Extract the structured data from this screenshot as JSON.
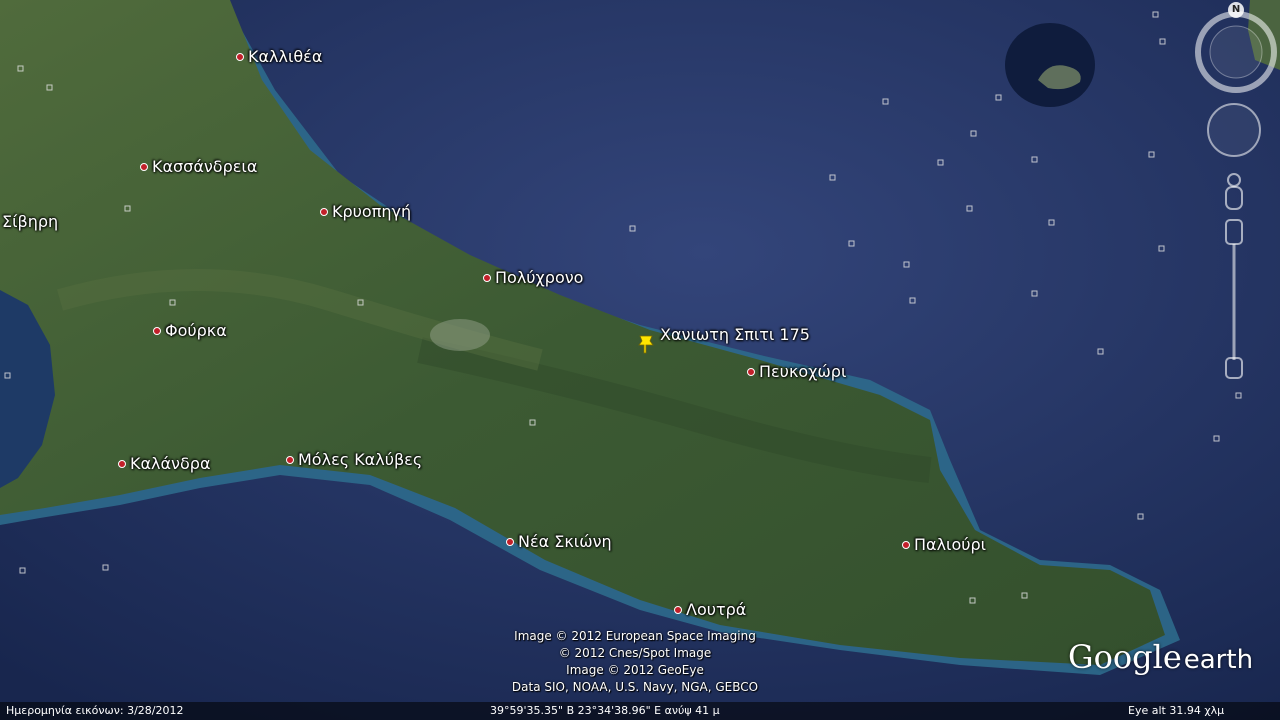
{
  "places": [
    {
      "name": "Καλλιθέα"
    },
    {
      "name": "Κασσάνδρεια"
    },
    {
      "name": "Σίβηρη"
    },
    {
      "name": "Κρυοπηγή"
    },
    {
      "name": "Πολύχρονο"
    },
    {
      "name": "Φούρκα"
    },
    {
      "name": "Πευκοχώρι"
    },
    {
      "name": "Καλάνδρα"
    },
    {
      "name": "Μόλες Καλύβες"
    },
    {
      "name": "Νέα Σκιώνη"
    },
    {
      "name": "Παλιούρι"
    },
    {
      "name": "Λουτρά"
    }
  ],
  "pin": {
    "label": "Χανιωτη Σπιτι 175",
    "color": "#ffe600",
    "icon": "pushpin-icon"
  },
  "credits": [
    "Image © 2012 European Space Imaging",
    "© 2012 Cnes/Spot Image",
    "Image © 2012 GeoEye",
    "Data SIO, NOAA, U.S. Navy, NGA, GEBCO"
  ],
  "logo": {
    "google": "Google",
    "earth": "earth"
  },
  "status": {
    "imagery_date": "Ημερομηνία εικόνων: 3/28/2012",
    "coordinates": "39°59'35.35\" Β  23°34'38.96\" Ε  ανύψ  41 μ",
    "eye_alt": "Eye alt   31.94 χλμ"
  },
  "nav": {
    "north": "N",
    "compass_icon": "compass-ring-icon",
    "look_icon": "look-joystick-icon",
    "pegman_icon": "pegman-icon",
    "zoom_icon": "zoom-slider-icon"
  },
  "colors": {
    "sea": "#1e2f5a",
    "land": "#3f5a34",
    "shallow": "#2e6f8f",
    "marker": "#c2202a"
  }
}
